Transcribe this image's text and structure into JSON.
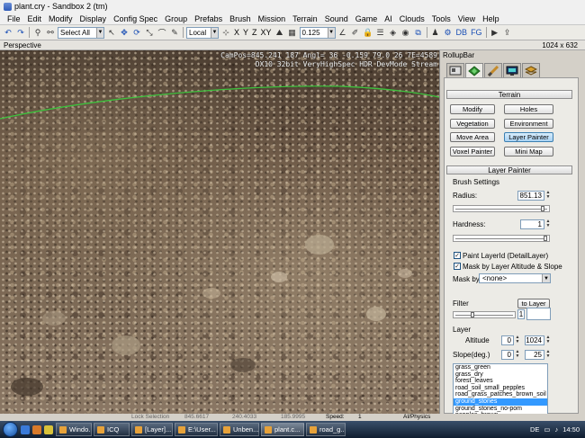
{
  "window": {
    "title": "plant.cry - Sandbox 2 (tm)"
  },
  "menu": [
    "File",
    "Edit",
    "Modify",
    "Display",
    "Config Spec",
    "Group",
    "Prefabs",
    "Brush",
    "Mission",
    "Terrain",
    "Sound",
    "Game",
    "AI",
    "Clouds",
    "Tools",
    "View",
    "Help"
  ],
  "toolbar": {
    "select_mode": "Select All",
    "coord_system": "Local",
    "axes": [
      "X",
      "Y",
      "Z",
      "XY"
    ],
    "grid_snap": "0.125"
  },
  "viewport": {
    "mode": "Perspective",
    "resolution": "1024 x 632",
    "campos": "CamPos=845.241 187 Angl= 36 -0.159 79.0 26 7E=4589",
    "render_info": "DX10 32bit VeryHighSpec HDR DevMode Stream"
  },
  "rollup": {
    "title": "RollupBar",
    "tabs": [
      "objects-tab-icon",
      "terrain-tab-icon",
      "brush-tab-icon",
      "display-tab-icon",
      "layers-tab-icon"
    ],
    "terrain": {
      "header": "Terrain",
      "buttons": [
        "Modify",
        "Holes",
        "Vegetation",
        "Environment",
        "Move Area",
        "Layer Painter",
        "Voxel Painter",
        "Mini Map"
      ],
      "active_button": "Layer Painter"
    },
    "layer_painter": {
      "header": "Layer Painter",
      "brush_settings": "Brush Settings",
      "radius_label": "Radius:",
      "radius_value": "851.13",
      "radius_fraction": 0.97,
      "hardness_label": "Hardness:",
      "hardness_value": "1",
      "hardness_fraction": 1.0,
      "paint_layer_id": "Paint LayerId (DetailLayer)",
      "paint_layer_id_checked": true,
      "mask_altitude": "Mask by Layer Altitude & Slope",
      "mask_altitude_checked": true,
      "mask_by_label": "Mask by",
      "mask_by_value": "<none>",
      "filter_label": "Filter",
      "to_layer_label": "to Layer",
      "filter_value": "1",
      "filter_fraction": 0.3,
      "layer_label": "Layer",
      "altitude_label": "Altitude",
      "altitude_min": "0",
      "altitude_max": "1024",
      "slope_label": "Slope(deg.)",
      "slope_min": "0",
      "slope_max": "25",
      "layers": [
        "grass_green",
        "grass_dry",
        "forest_leaves",
        "road_soil_small_pepples",
        "road_grass_patches_brown_soil",
        "ground_stones",
        "ground_stones_no-pom",
        "pepples_brown"
      ],
      "selected_layer": "ground_stones"
    }
  },
  "status": {
    "lock_selection": "Lock Selection",
    "x": "845.6617",
    "y": "240.4033",
    "z": "185.9995",
    "speed_label": "Speed:",
    "speed": "1",
    "ai_physics": "AI/Physics"
  },
  "taskbar": {
    "tasks": [
      "Windo...",
      "ICQ",
      "[Layer]...",
      "E:\\User...",
      "Unben...",
      "plant.c...",
      "road_g..."
    ],
    "active_task": "plant.c...",
    "language": "DE",
    "clock": "14:50"
  }
}
